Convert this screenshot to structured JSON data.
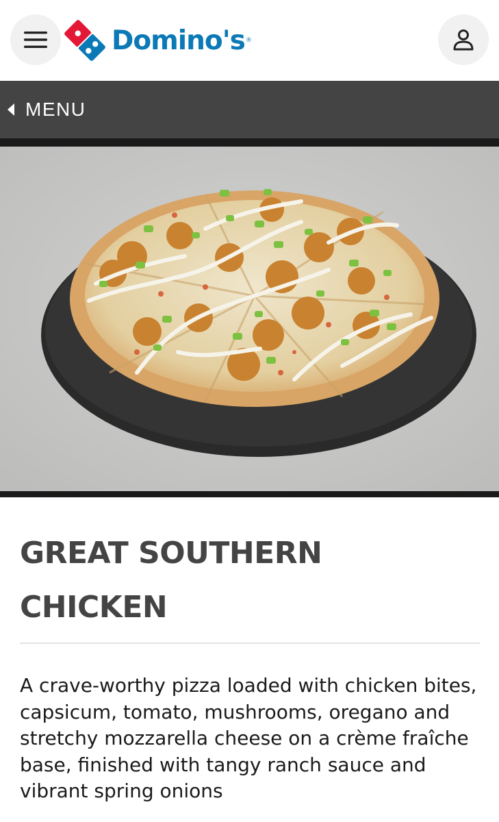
{
  "header": {
    "menu_icon": "hamburger-menu-icon",
    "brand": "Domino's",
    "account_icon": "person-icon"
  },
  "nav": {
    "back_label": "MENU"
  },
  "product": {
    "title": "GREAT SOUTHERN CHICKEN",
    "description": "A crave-worthy pizza loaded with chicken bites, capsicum, tomato, mushrooms, oregano and stretchy mozzarella cheese on a crème fraîche base, finished with tangy ranch sauce and vibrant spring onions"
  },
  "colors": {
    "brand_blue": "#0a79b6",
    "brand_red": "#e31837",
    "menu_bar": "#444444"
  }
}
